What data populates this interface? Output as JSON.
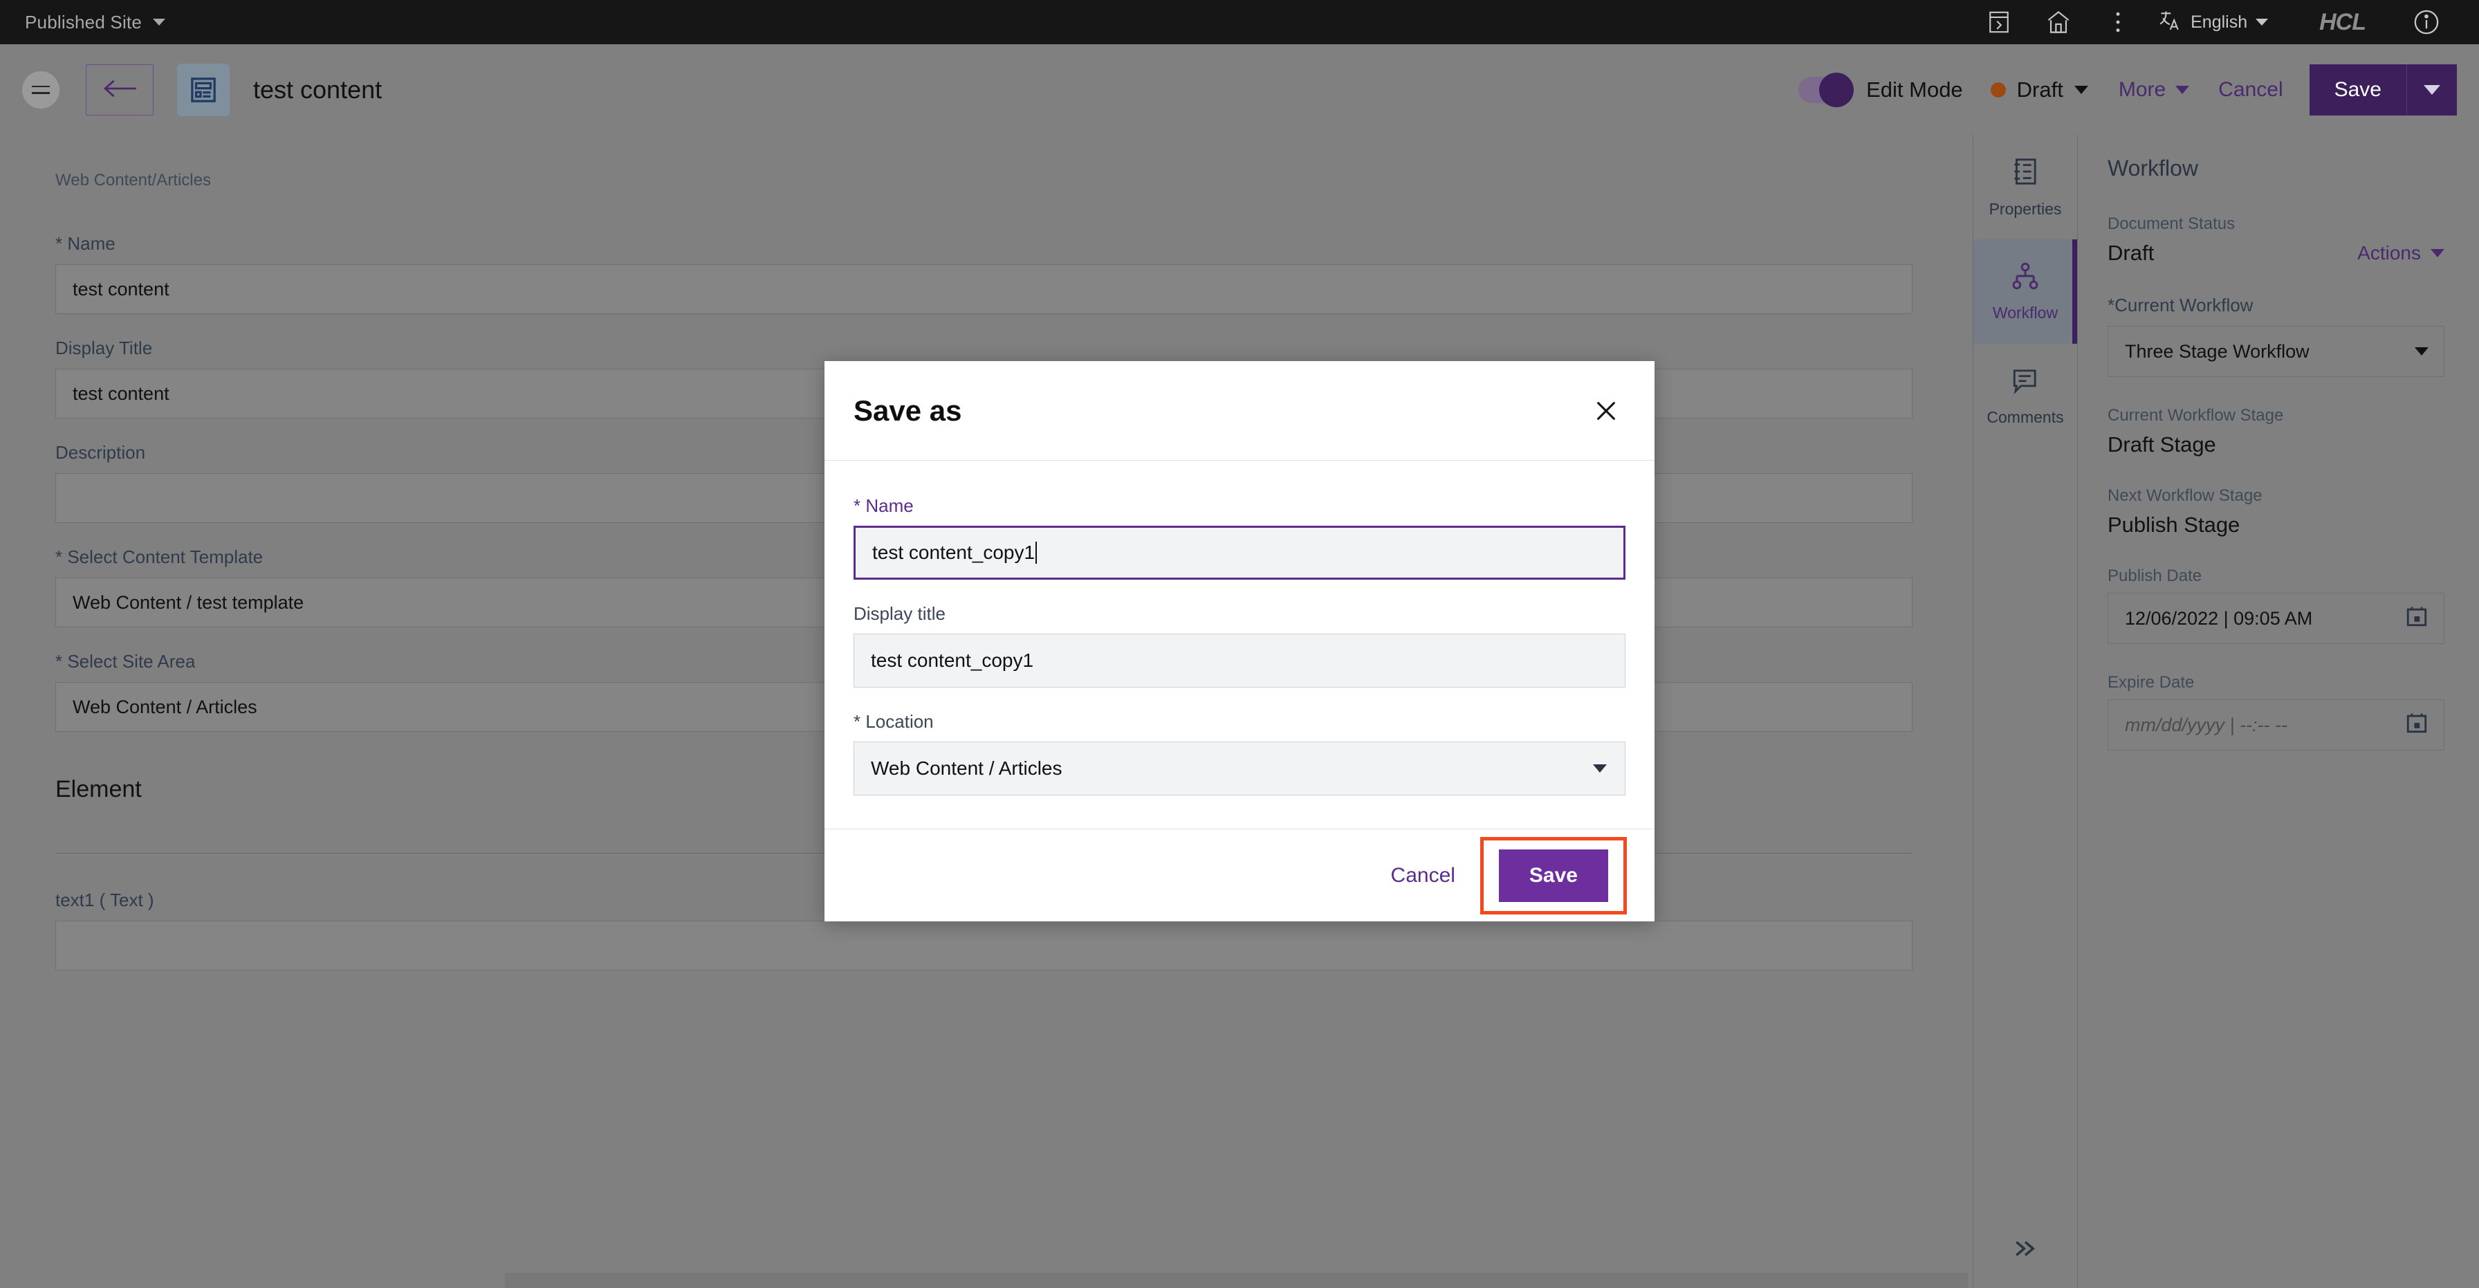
{
  "topbar": {
    "site_selector": "Published Site",
    "language": "English",
    "brand": "HCL",
    "icons": [
      "panel-icon",
      "home-icon",
      "overflow-menu-icon",
      "translate-icon",
      "info-icon"
    ]
  },
  "toolbar": {
    "back_label": "back-arrow",
    "doc_title": "test content",
    "edit_mode_label": "Edit Mode",
    "status_label": "Draft",
    "status_color": "#9c4a12",
    "more_label": "More",
    "cancel_label": "Cancel",
    "save_label": "Save"
  },
  "form": {
    "breadcrumb": "Web Content/Articles",
    "fields": [
      {
        "label": "* Name",
        "value": "test content"
      },
      {
        "label": "Display Title",
        "value": "test content"
      },
      {
        "label": "Description",
        "value": ""
      },
      {
        "label": "* Select Content Template",
        "value": "Web Content / test template"
      },
      {
        "label": "* Select Site Area",
        "value": "Web Content / Articles"
      }
    ],
    "section_heading": "Element",
    "element_field": {
      "label": "text1 ( Text )",
      "value": ""
    }
  },
  "rail": {
    "items": [
      {
        "label": "Properties",
        "icon": "properties-icon",
        "active": false
      },
      {
        "label": "Workflow",
        "icon": "workflow-icon",
        "active": true
      },
      {
        "label": "Comments",
        "icon": "comments-icon",
        "active": false
      }
    ],
    "collapse_icon": "chevron-double-right-icon"
  },
  "workflow": {
    "title": "Workflow",
    "document_status_label": "Document Status",
    "document_status_value": "Draft",
    "actions_label": "Actions",
    "current_workflow_label": "*Current Workflow",
    "current_workflow_value": "Three Stage Workflow",
    "current_stage_label": "Current Workflow Stage",
    "current_stage_value": "Draft Stage",
    "next_stage_label": "Next Workflow Stage",
    "next_stage_value": "Publish Stage",
    "publish_date_label": "Publish Date",
    "publish_date_value": "12/06/2022 | 09:05 AM",
    "expire_date_label": "Expire Date",
    "expire_date_placeholder": "mm/dd/yyyy | --:-- --"
  },
  "modal": {
    "title": "Save as",
    "close_icon": "close-icon",
    "name_label": "* Name",
    "name_value": "test content_copy1",
    "display_title_label": "Display title",
    "display_title_value": "test content_copy1",
    "location_label": "* Location",
    "location_value": "Web Content / Articles",
    "cancel_label": "Cancel",
    "save_label": "Save",
    "highlight_color": "#f4481f",
    "accent_color": "#6d2f9e"
  }
}
